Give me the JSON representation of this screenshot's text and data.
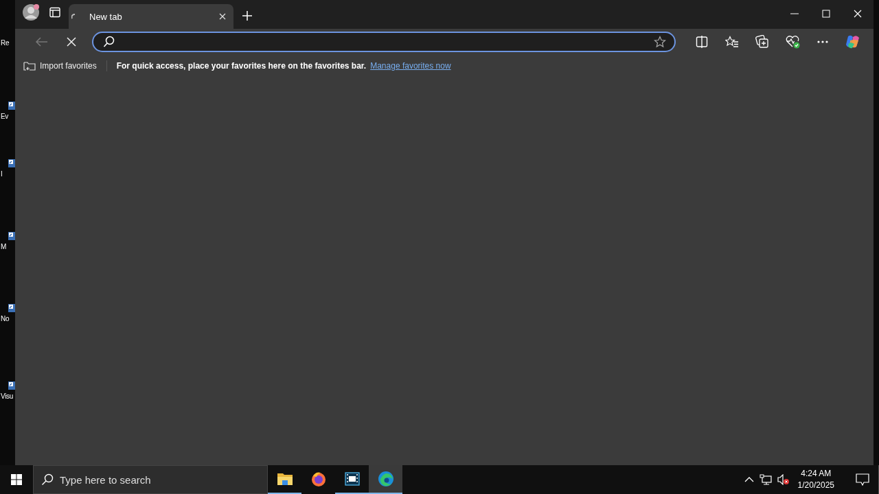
{
  "desktop_icons": [
    {
      "label": "Re"
    },
    {
      "label": "Ev"
    },
    {
      "label": "I"
    },
    {
      "label": "M"
    },
    {
      "label": "No"
    },
    {
      "label": "Visu"
    }
  ],
  "browser": {
    "tabs": [
      {
        "title": "New tab",
        "selected": true,
        "loading": true
      }
    ],
    "back_disabled": true,
    "address_bar": {
      "focused": true
    },
    "favorites_bar": {
      "import_label": "Import favorites",
      "hint": "For quick access, place your favorites here on the favorites bar.",
      "link": "Manage favorites now"
    }
  },
  "taskbar": {
    "search_placeholder": "Type here to search",
    "apps": [
      {
        "kind": "explorer",
        "running": true,
        "selected": false
      },
      {
        "kind": "firefox",
        "running": false,
        "selected": false
      },
      {
        "kind": "video",
        "running": true,
        "selected": false
      },
      {
        "kind": "edge",
        "running": true,
        "selected": true
      }
    ],
    "time": "4:24 AM",
    "date": "1/20/2025"
  }
}
